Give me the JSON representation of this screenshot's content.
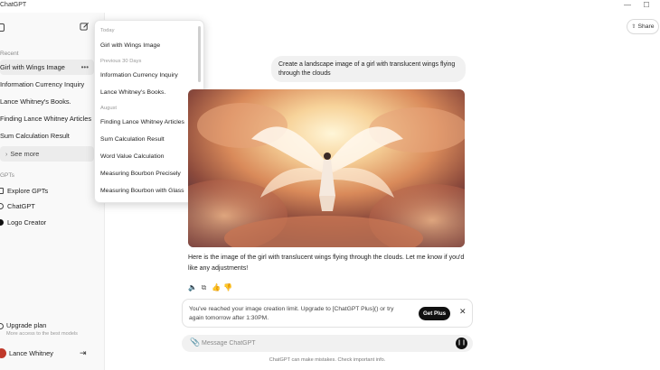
{
  "window": {
    "title": "ChatGPT",
    "minimize": "—",
    "maximize": "☐"
  },
  "sidebar": {
    "recent_label": "Recent",
    "history": [
      {
        "label": "Girl with Wings Image",
        "active": true
      },
      {
        "label": "Information Currency Inquiry"
      },
      {
        "label": "Lance Whitney's Books."
      },
      {
        "label": "Finding Lance Whitney Articles"
      },
      {
        "label": "Sum Calculation Result"
      }
    ],
    "see_more": "See more",
    "gpts_label": "GPTs",
    "gpts": [
      "Explore GPTs",
      "ChatGPT",
      "Logo Creator"
    ],
    "upgrade_title": "Upgrade plan",
    "upgrade_subtitle": "More access to the best models",
    "user_name": "Lance Whitney"
  },
  "popup": {
    "sections": [
      {
        "label": "Today",
        "items": [
          "Girl with Wings Image"
        ]
      },
      {
        "label": "Previous 30 Days",
        "items": [
          "Information Currency Inquiry",
          "Lance Whitney's Books."
        ]
      },
      {
        "label": "August",
        "items": [
          "Finding Lance Whitney Articles",
          "Sum Calculation Result",
          "Word Value Calculation",
          "Measuring Bourbon Precisely",
          "Measuring Bourbon with Glass"
        ]
      }
    ]
  },
  "header": {
    "share_label": "Share"
  },
  "chat": {
    "user_message": "Create a landscape image of a girl with translucent wings flying through the clouds",
    "assistant_reply": "Here is the image of the girl with translucent wings flying through the clouds. Let me know if you'd like any adjustments!"
  },
  "limit_notice": {
    "text": "You've reached your image creation limit. Upgrade to [ChatGPT Plus]() or try again tomorrow after 1:30PM.",
    "button": "Get Plus"
  },
  "composer": {
    "placeholder": "Message ChatGPT"
  },
  "disclaimer": "ChatGPT can make mistakes. Check important info.",
  "colors": {
    "accent": "#111111",
    "sidebar_bg": "#f9f9f9",
    "bubble_bg": "#f1f1f1",
    "avatar": "#c0392b"
  }
}
